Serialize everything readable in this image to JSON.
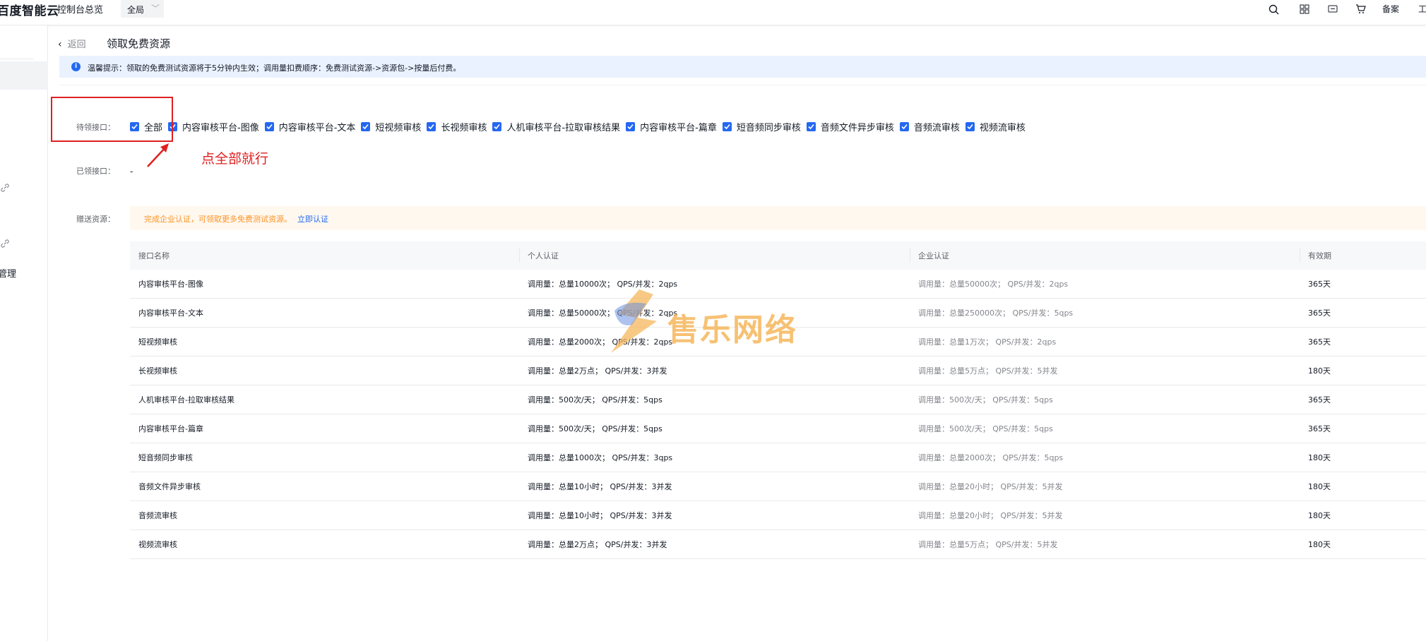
{
  "topbar": {
    "logo": "百度智能云",
    "console_label": "控制台总览",
    "region": "全局",
    "beian": "备案",
    "work_order": "工"
  },
  "sidebar": {
    "partial_item": "管理"
  },
  "header": {
    "back_label": "返回",
    "title": "领取免费资源"
  },
  "notice": {
    "text": "温馨提示：领取的免费测试资源将于5分钟内生效；调用量扣费顺序：免费测试资源->资源包->按量后付费。"
  },
  "pending": {
    "label": "待领接口：",
    "options": [
      {
        "label": "全部",
        "checked": true
      },
      {
        "label": "内容审核平台-图像",
        "checked": true
      },
      {
        "label": "内容审核平台-文本",
        "checked": true
      },
      {
        "label": "短视频审核",
        "checked": true
      },
      {
        "label": "长视频审核",
        "checked": true
      },
      {
        "label": "人机审核平台-拉取审核结果",
        "checked": true
      },
      {
        "label": "内容审核平台-篇章",
        "checked": true
      },
      {
        "label": "短音频同步审核",
        "checked": true
      },
      {
        "label": "音频文件异步审核",
        "checked": true
      },
      {
        "label": "音频流审核",
        "checked": true
      },
      {
        "label": "视频流审核",
        "checked": true
      }
    ]
  },
  "annotation": {
    "text": "点全部就行",
    "color": "#e02020"
  },
  "received": {
    "label": "已领接口：",
    "value": "-"
  },
  "gift": {
    "label": "赠送资源：",
    "notice": "完成企业认证，可领取更多免费测试资源。",
    "link": "立即认证"
  },
  "table": {
    "headers": [
      "接口名称",
      "个人认证",
      "企业认证",
      "有效期"
    ],
    "rows": [
      [
        "内容审核平台-图像",
        "调用量：总量10000次； QPS/并发：2qps",
        "调用量：总量50000次； QPS/并发：2qps",
        "365天"
      ],
      [
        "内容审核平台-文本",
        "调用量：总量50000次； QPS/并发：2qps",
        "调用量：总量250000次； QPS/并发：5qps",
        "365天"
      ],
      [
        "短视频审核",
        "调用量：总量2000次； QPS/并发：2qps",
        "调用量：总量1万次； QPS/并发：2qps",
        "365天"
      ],
      [
        "长视频审核",
        "调用量：总量2万点； QPS/并发：3并发",
        "调用量：总量5万点； QPS/并发：5并发",
        "180天"
      ],
      [
        "人机审核平台-拉取审核结果",
        "调用量：500次/天； QPS/并发：5qps",
        "调用量：500次/天； QPS/并发：5qps",
        "365天"
      ],
      [
        "内容审核平台-篇章",
        "调用量：500次/天； QPS/并发：5qps",
        "调用量：500次/天； QPS/并发：5qps",
        "365天"
      ],
      [
        "短音频同步审核",
        "调用量：总量1000次； QPS/并发：3qps",
        "调用量：总量2000次； QPS/并发：5qps",
        "180天"
      ],
      [
        "音频文件异步审核",
        "调用量：总量10小时； QPS/并发：3并发",
        "调用量：总量20小时； QPS/并发：5并发",
        "180天"
      ],
      [
        "音频流审核",
        "调用量：总量10小时； QPS/并发：3并发",
        "调用量：总量20小时； QPS/并发：5并发",
        "180天"
      ],
      [
        "视频流审核",
        "调用量：总量2万点； QPS/并发：3并发",
        "调用量：总量5万点； QPS/并发：5并发",
        "180天"
      ]
    ]
  },
  "watermark": {
    "text": "售乐网络"
  },
  "colors": {
    "primary": "#2468f2",
    "notice_bg": "#eaf2ff",
    "warn": "#ff9326",
    "annotation": "#e02020"
  }
}
